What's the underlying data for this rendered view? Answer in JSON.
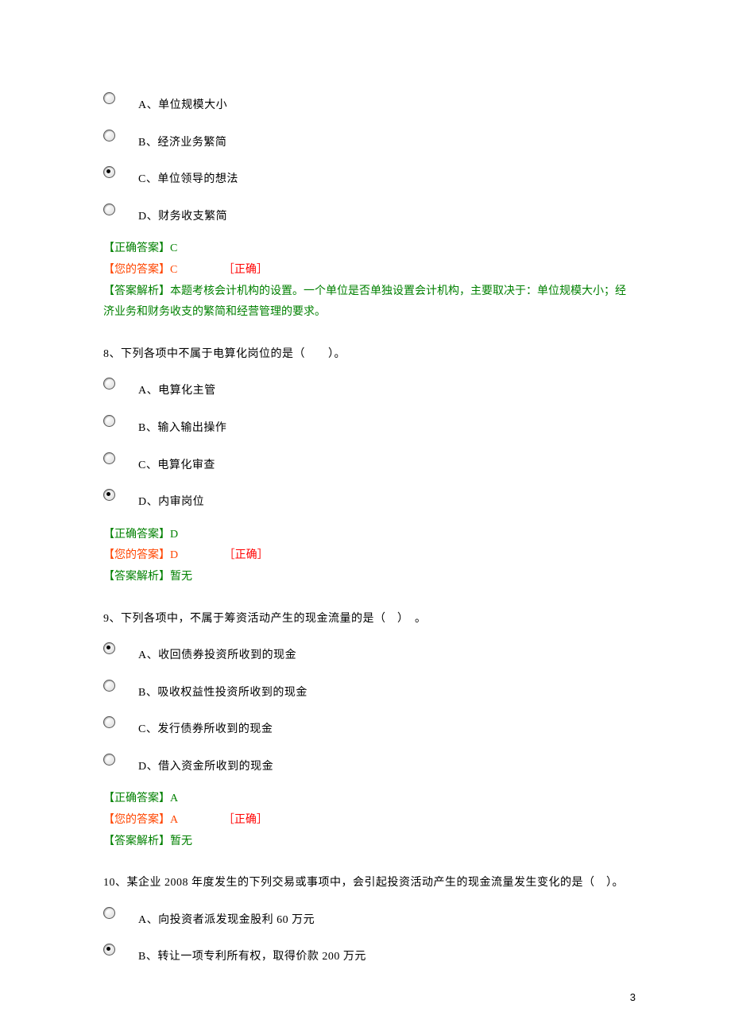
{
  "page_number": "3",
  "questions": [
    {
      "number": "",
      "stem": "",
      "options": [
        {
          "label": "A、单位规模大小",
          "checked": false
        },
        {
          "label": "B、经济业务繁简",
          "checked": false
        },
        {
          "label": "C、单位领导的想法",
          "checked": true
        },
        {
          "label": "D、财务收支繁简",
          "checked": false
        }
      ],
      "correct_prefix": "【正确答案】",
      "correct_value": "C",
      "your_prefix": "【您的答案】",
      "your_value": "C",
      "status": "［正确］",
      "explain_prefix": "【答案解析】",
      "explain_text": "本题考核会计机构的设置。一个单位是否单独设置会计机构，主要取决于：单位规模大小；经济业务和财务收支的繁简和经营管理的要求。"
    },
    {
      "number": "8、",
      "stem": "下列各项中不属于电算化岗位的是（　　）。",
      "options": [
        {
          "label": "A、电算化主管",
          "checked": false
        },
        {
          "label": "B、输入输出操作",
          "checked": false
        },
        {
          "label": "C、电算化审查",
          "checked": false
        },
        {
          "label": "D、内审岗位",
          "checked": true
        }
      ],
      "correct_prefix": "【正确答案】",
      "correct_value": "D",
      "your_prefix": "【您的答案】",
      "your_value": "D",
      "status": "［正确］",
      "explain_prefix": "【答案解析】",
      "explain_text": "暂无"
    },
    {
      "number": "9、",
      "stem": "下列各项中，不属于筹资活动产生的现金流量的是（　）　。",
      "options": [
        {
          "label": "A、收回债券投资所收到的现金",
          "checked": true
        },
        {
          "label": "B、吸收权益性投资所收到的现金",
          "checked": false
        },
        {
          "label": "C、发行债券所收到的现金",
          "checked": false
        },
        {
          "label": "D、借入资金所收到的现金",
          "checked": false
        }
      ],
      "correct_prefix": "【正确答案】",
      "correct_value": "A",
      "your_prefix": "【您的答案】",
      "your_value": "A",
      "status": "［正确］",
      "explain_prefix": "【答案解析】",
      "explain_text": "暂无"
    },
    {
      "number": "10、",
      "stem": "某企业 2008 年度发生的下列交易或事项中，会引起投资活动产生的现金流量发生变化的是（　）。",
      "options": [
        {
          "label": "A、向投资者派发现金股利 60 万元",
          "checked": false
        },
        {
          "label": "B、转让一项专利所有权，取得价款 200 万元",
          "checked": true
        }
      ],
      "correct_prefix": "",
      "correct_value": "",
      "your_prefix": "",
      "your_value": "",
      "status": "",
      "explain_prefix": "",
      "explain_text": ""
    }
  ]
}
